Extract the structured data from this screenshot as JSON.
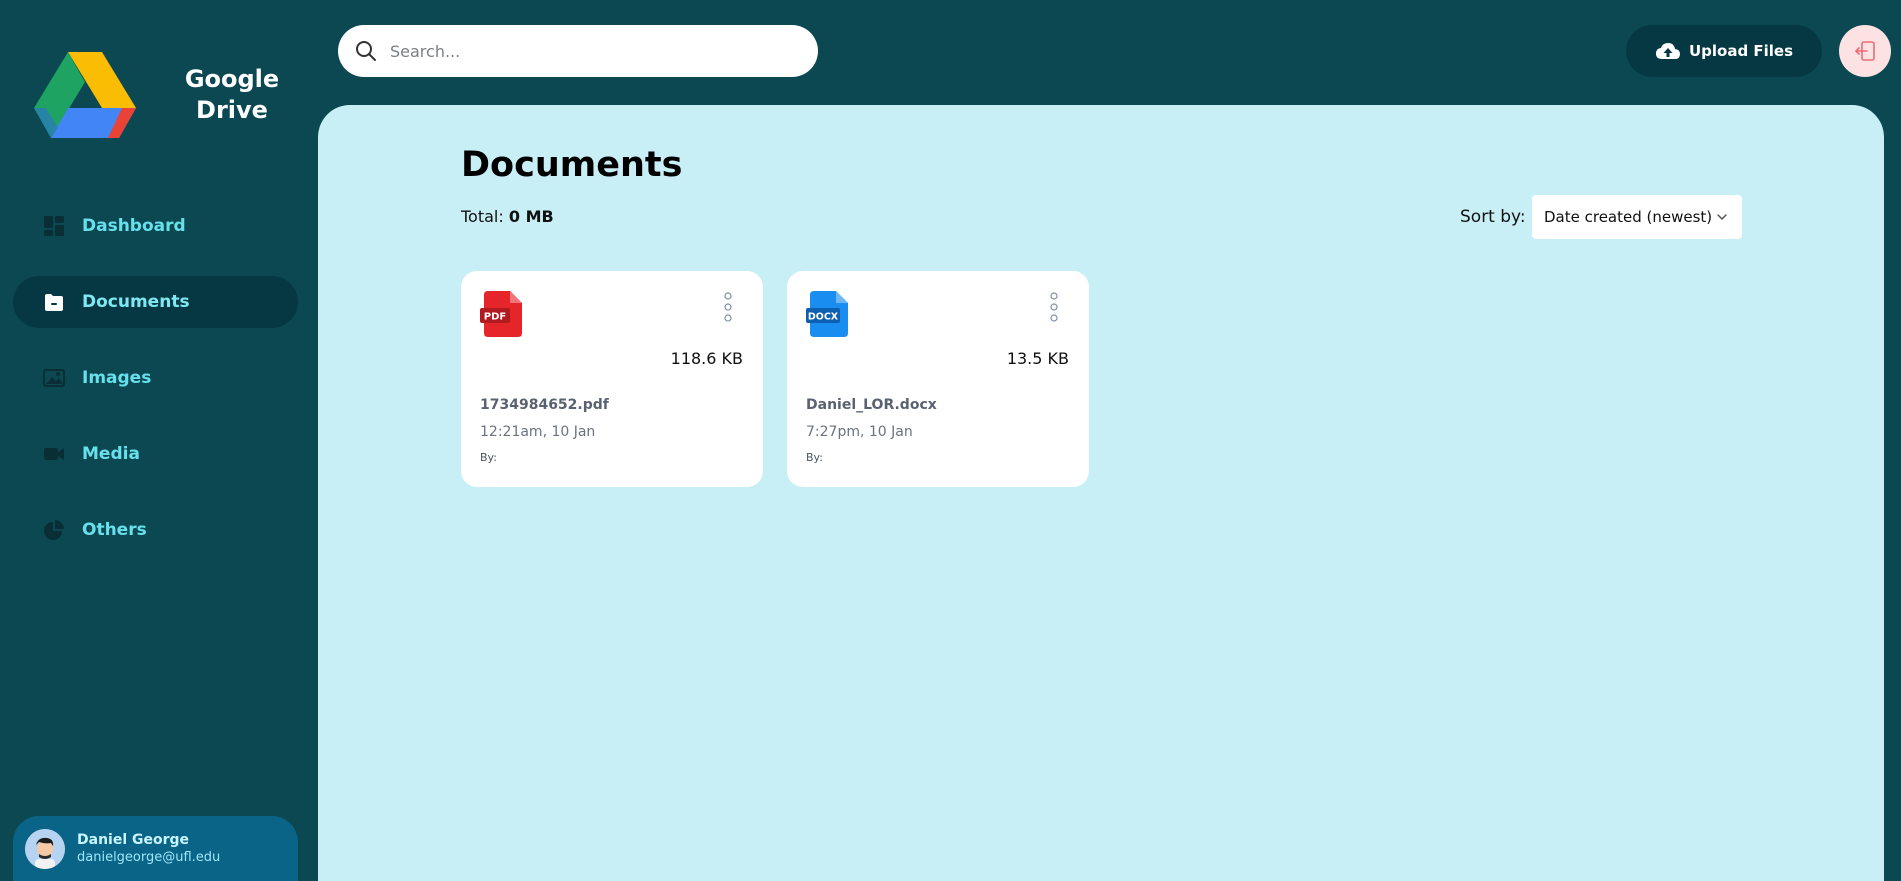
{
  "brand": {
    "name_line1": "Google",
    "name_line2": "Drive"
  },
  "sidebar": {
    "items": [
      {
        "label": "Dashboard",
        "icon": "dashboard-icon",
        "active": false
      },
      {
        "label": "Documents",
        "icon": "documents-icon",
        "active": true
      },
      {
        "label": "Images",
        "icon": "images-icon",
        "active": false
      },
      {
        "label": "Media",
        "icon": "media-icon",
        "active": false
      },
      {
        "label": "Others",
        "icon": "others-icon",
        "active": false
      }
    ]
  },
  "user": {
    "name": "Daniel George",
    "email": "danielgeorge@ufl.edu"
  },
  "header": {
    "search_placeholder": "Search...",
    "upload_label": "Upload Files"
  },
  "main": {
    "title": "Documents",
    "total_label": "Total:",
    "total_value": "0 MB",
    "sort_label": "Sort by:",
    "sort_selected": "Date created (newest)"
  },
  "files": [
    {
      "type_badge": "PDF",
      "size": "118.6 KB",
      "name": "1734984652.pdf",
      "date": "12:21am, 10 Jan",
      "by": "By:"
    },
    {
      "type_badge": "DOCX",
      "size": "13.5 KB",
      "name": "Daniel_LOR.docx",
      "date": "7:27pm, 10 Jan",
      "by": "By:"
    }
  ],
  "colors": {
    "sidebar_bg": "#0b4852",
    "main_bg": "#c9eff6",
    "accent": "#67e0ec",
    "pdf_red": "#e5252a",
    "docx_blue": "#1a8ef0"
  }
}
